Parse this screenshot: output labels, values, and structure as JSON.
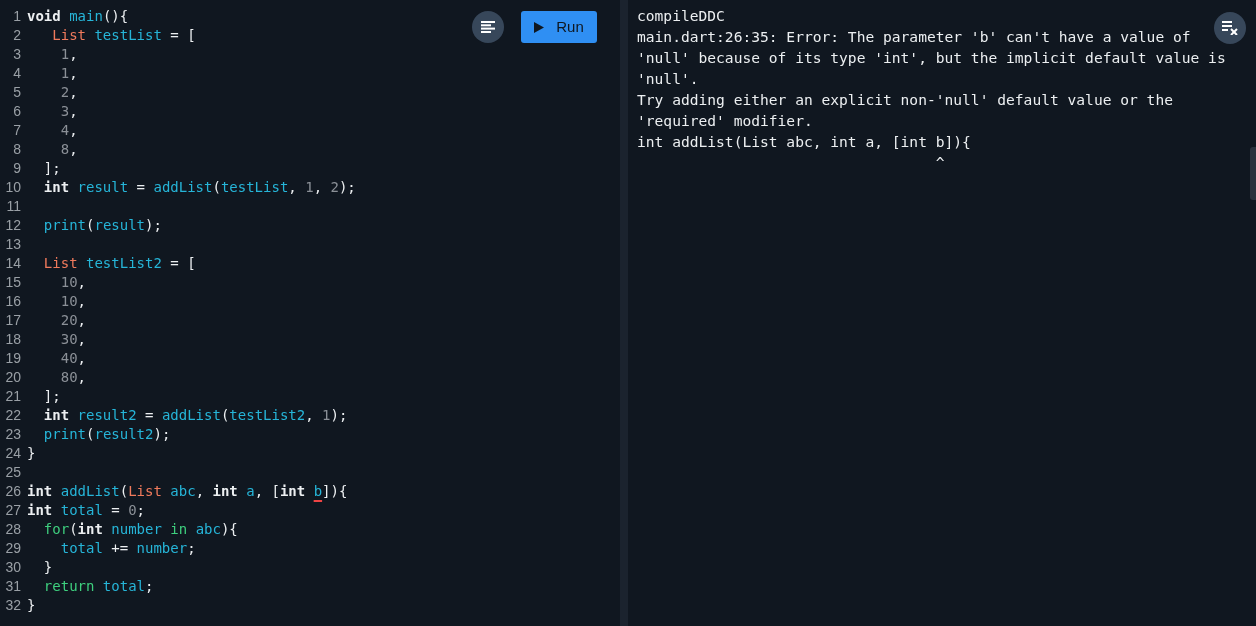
{
  "editor": {
    "lines": [
      {
        "number": "1",
        "tokens": [
          {
            "kind": "kw",
            "text": "void "
          },
          {
            "kind": "id",
            "text": "main"
          },
          {
            "kind": "p",
            "text": "(){"
          }
        ]
      },
      {
        "number": "2",
        "tokens": [
          {
            "kind": "type",
            "text": "   List "
          },
          {
            "kind": "id",
            "text": "testList"
          },
          {
            "kind": "p",
            "text": " = ["
          }
        ]
      },
      {
        "number": "3",
        "tokens": [
          {
            "kind": "num",
            "text": "    1"
          },
          {
            "kind": "p",
            "text": ","
          }
        ]
      },
      {
        "number": "4",
        "tokens": [
          {
            "kind": "num",
            "text": "    1"
          },
          {
            "kind": "p",
            "text": ","
          }
        ]
      },
      {
        "number": "5",
        "tokens": [
          {
            "kind": "num",
            "text": "    2"
          },
          {
            "kind": "p",
            "text": ","
          }
        ]
      },
      {
        "number": "6",
        "tokens": [
          {
            "kind": "num",
            "text": "    3"
          },
          {
            "kind": "p",
            "text": ","
          }
        ]
      },
      {
        "number": "7",
        "tokens": [
          {
            "kind": "num",
            "text": "    4"
          },
          {
            "kind": "p",
            "text": ","
          }
        ]
      },
      {
        "number": "8",
        "tokens": [
          {
            "kind": "num",
            "text": "    8"
          },
          {
            "kind": "p",
            "text": ","
          }
        ]
      },
      {
        "number": "9",
        "tokens": [
          {
            "kind": "p",
            "text": "  ];"
          }
        ]
      },
      {
        "number": "10",
        "tokens": [
          {
            "kind": "kw",
            "text": "  int "
          },
          {
            "kind": "id",
            "text": "result"
          },
          {
            "kind": "p",
            "text": " = "
          },
          {
            "kind": "id",
            "text": "addList"
          },
          {
            "kind": "p",
            "text": "("
          },
          {
            "kind": "id",
            "text": "testList"
          },
          {
            "kind": "p",
            "text": ", "
          },
          {
            "kind": "num",
            "text": "1"
          },
          {
            "kind": "p",
            "text": ", "
          },
          {
            "kind": "num",
            "text": "2"
          },
          {
            "kind": "p",
            "text": ");"
          }
        ]
      },
      {
        "number": "11"
      },
      {
        "number": "12",
        "tokens": [
          {
            "kind": "id",
            "text": "  print"
          },
          {
            "kind": "p",
            "text": "("
          },
          {
            "kind": "id",
            "text": "result"
          },
          {
            "kind": "p",
            "text": ");"
          }
        ]
      },
      {
        "number": "13"
      },
      {
        "number": "14",
        "tokens": [
          {
            "kind": "type",
            "text": "  List "
          },
          {
            "kind": "id",
            "text": "testList2"
          },
          {
            "kind": "p",
            "text": " = ["
          }
        ]
      },
      {
        "number": "15",
        "tokens": [
          {
            "kind": "num",
            "text": "    10"
          },
          {
            "kind": "p",
            "text": ","
          }
        ]
      },
      {
        "number": "16",
        "tokens": [
          {
            "kind": "num",
            "text": "    10"
          },
          {
            "kind": "p",
            "text": ","
          }
        ]
      },
      {
        "number": "17",
        "tokens": [
          {
            "kind": "num",
            "text": "    20"
          },
          {
            "kind": "p",
            "text": ","
          }
        ]
      },
      {
        "number": "18",
        "tokens": [
          {
            "kind": "num",
            "text": "    30"
          },
          {
            "kind": "p",
            "text": ","
          }
        ]
      },
      {
        "number": "19",
        "tokens": [
          {
            "kind": "num",
            "text": "    40"
          },
          {
            "kind": "p",
            "text": ","
          }
        ]
      },
      {
        "number": "20",
        "tokens": [
          {
            "kind": "num",
            "text": "    80"
          },
          {
            "kind": "p",
            "text": ","
          }
        ]
      },
      {
        "number": "21",
        "tokens": [
          {
            "kind": "p",
            "text": "  ];"
          }
        ]
      },
      {
        "number": "22",
        "tokens": [
          {
            "kind": "kw",
            "text": "  int "
          },
          {
            "kind": "id",
            "text": "result2"
          },
          {
            "kind": "p",
            "text": " = "
          },
          {
            "kind": "id",
            "text": "addList"
          },
          {
            "kind": "p",
            "text": "("
          },
          {
            "kind": "id",
            "text": "testList2"
          },
          {
            "kind": "p",
            "text": ", "
          },
          {
            "kind": "num",
            "text": "1"
          },
          {
            "kind": "p",
            "text": ");"
          }
        ]
      },
      {
        "number": "23",
        "tokens": [
          {
            "kind": "id",
            "text": "  print"
          },
          {
            "kind": "p",
            "text": "("
          },
          {
            "kind": "id",
            "text": "result2"
          },
          {
            "kind": "p",
            "text": ");"
          }
        ]
      },
      {
        "number": "24",
        "tokens": [
          {
            "kind": "p",
            "text": "}"
          }
        ]
      },
      {
        "number": "25"
      },
      {
        "number": "26",
        "tokens": [
          {
            "kind": "kw",
            "text": "int "
          },
          {
            "kind": "id",
            "text": "addList"
          },
          {
            "kind": "p",
            "text": "("
          },
          {
            "kind": "type",
            "text": "List "
          },
          {
            "kind": "id",
            "text": "abc"
          },
          {
            "kind": "p",
            "text": ", "
          },
          {
            "kind": "kw",
            "text": "int "
          },
          {
            "kind": "id",
            "text": "a"
          },
          {
            "kind": "p",
            "text": ", ["
          },
          {
            "kind": "kw",
            "text": "int "
          },
          {
            "kind": "err",
            "text": "b"
          },
          {
            "kind": "p",
            "text": "]){"
          }
        ]
      },
      {
        "number": "27",
        "tokens": [
          {
            "kind": "kw",
            "text": "int "
          },
          {
            "kind": "id",
            "text": "total"
          },
          {
            "kind": "p",
            "text": " = "
          },
          {
            "kind": "num",
            "text": "0"
          },
          {
            "kind": "p",
            "text": ";"
          }
        ]
      },
      {
        "number": "28",
        "tokens": [
          {
            "kind": "ctl",
            "text": "  for"
          },
          {
            "kind": "p",
            "text": "("
          },
          {
            "kind": "kw",
            "text": "int "
          },
          {
            "kind": "id",
            "text": "number "
          },
          {
            "kind": "ctl",
            "text": "in "
          },
          {
            "kind": "id",
            "text": "abc"
          },
          {
            "kind": "p",
            "text": "){"
          }
        ]
      },
      {
        "number": "29",
        "tokens": [
          {
            "kind": "id",
            "text": "    total"
          },
          {
            "kind": "p",
            "text": " += "
          },
          {
            "kind": "id",
            "text": "number"
          },
          {
            "kind": "p",
            "text": ";"
          }
        ]
      },
      {
        "number": "30",
        "tokens": [
          {
            "kind": "p",
            "text": "  }"
          }
        ]
      },
      {
        "number": "31",
        "tokens": [
          {
            "kind": "ctl",
            "text": "  return "
          },
          {
            "kind": "id",
            "text": "total"
          },
          {
            "kind": "p",
            "text": ";"
          }
        ]
      },
      {
        "number": "32",
        "tokens": [
          {
            "kind": "p",
            "text": "}"
          }
        ]
      }
    ]
  },
  "toolbar": {
    "run_button": "Run"
  },
  "console": {
    "lines": [
      "compileDDC",
      "main.dart:26:35: Error: The parameter 'b' can't have a value of",
      "'null' because of its type 'int', but the implicit default value is",
      "'null'.",
      "Try adding either an explicit non-'null' default value or the",
      "'required' modifier.",
      "int addList(List abc, int a, [int b]){",
      "                                  ^"
    ]
  }
}
